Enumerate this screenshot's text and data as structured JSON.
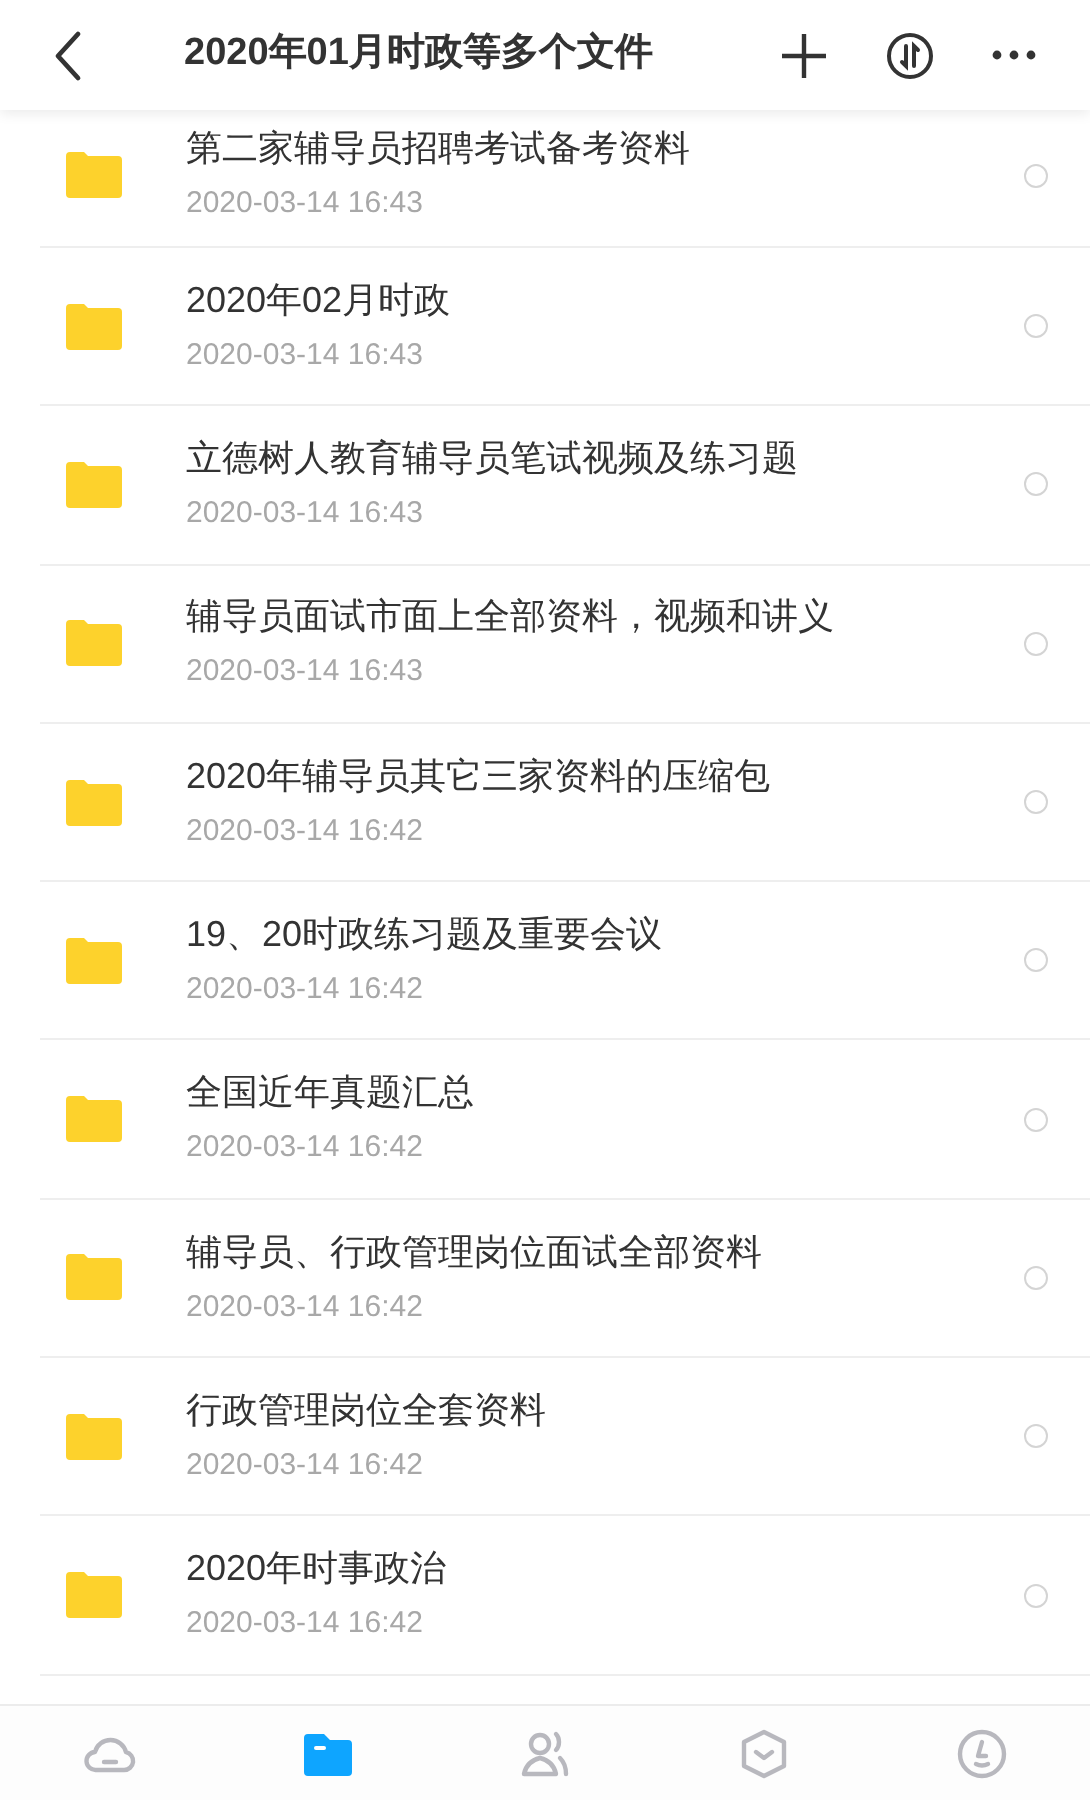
{
  "header": {
    "title": "2020年01月时政等多个文件"
  },
  "files": [
    {
      "name": "第二家辅导员招聘考试备考资料",
      "time": "2020-03-14 16:43",
      "selected": false
    },
    {
      "name": "2020年02月时政",
      "time": "2020-03-14 16:43",
      "selected": false
    },
    {
      "name": "立德树人教育辅导员笔试视频及练习题",
      "time": "2020-03-14 16:43",
      "selected": false
    },
    {
      "name": "辅导员面试市面上全部资料，视频和讲义",
      "time": "2020-03-14 16:43",
      "selected": false
    },
    {
      "name": "2020年辅导员其它三家资料的压缩包",
      "time": "2020-03-14 16:42",
      "selected": false
    },
    {
      "name": "19、20时政练习题及重要会议",
      "time": "2020-03-14 16:42",
      "selected": false
    },
    {
      "name": "全国近年真题汇总",
      "time": "2020-03-14 16:42",
      "selected": false
    },
    {
      "name": "辅导员、行政管理岗位面试全部资料",
      "time": "2020-03-14 16:42",
      "selected": false
    },
    {
      "name": "行政管理岗位全套资料",
      "time": "2020-03-14 16:42",
      "selected": false
    },
    {
      "name": "2020年时事政治",
      "time": "2020-03-14 16:42",
      "selected": false
    }
  ],
  "tab_bar": [
    {
      "kind": "cloud",
      "selected": false
    },
    {
      "kind": "folder",
      "selected": true
    },
    {
      "kind": "people",
      "selected": false
    },
    {
      "kind": "box",
      "selected": false
    },
    {
      "kind": "clock",
      "selected": false
    }
  ]
}
